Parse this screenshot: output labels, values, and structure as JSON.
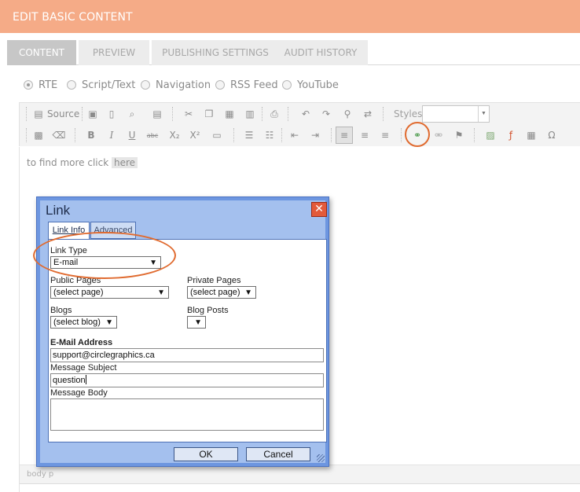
{
  "header": {
    "title": "EDIT BASIC CONTENT"
  },
  "tabs": [
    {
      "label": "CONTENT",
      "active": true
    },
    {
      "label": "PREVIEW",
      "active": false
    },
    {
      "label": "PUBLISHING SETTINGS",
      "active": false
    },
    {
      "label": "AUDIT HISTORY",
      "active": false
    }
  ],
  "content_types": {
    "options": [
      "RTE",
      "Script/Text",
      "Navigation",
      "RSS Feed",
      "YouTube"
    ],
    "selected": "RTE"
  },
  "toolbar": {
    "source_label": "Source",
    "styles_label": "Styles",
    "styles_value": "",
    "row1_icons": [
      "source-icon",
      "save-icon",
      "new-page-icon",
      "preview-icon",
      "templates-icon",
      "cut-icon",
      "copy-icon",
      "paste-icon",
      "paste-text-icon",
      "print-icon",
      "undo-icon",
      "redo-icon",
      "find-icon",
      "replace-icon"
    ],
    "row2_icons": [
      "select-all-icon",
      "remove-format-icon",
      "bold-icon",
      "italic-icon",
      "underline-icon",
      "strike-icon",
      "subscript-icon",
      "superscript-icon",
      "horizontal-rule-icon",
      "numbered-list-icon",
      "bulleted-list-icon",
      "outdent-icon",
      "indent-icon",
      "align-left-icon",
      "align-center-icon",
      "align-right-icon",
      "link-icon",
      "unlink-icon",
      "anchor-icon",
      "image-icon",
      "flash-icon",
      "table-icon",
      "special-char-icon"
    ],
    "glyphs": {
      "bold": "B",
      "italic": "I",
      "underline": "U",
      "strike": "abc",
      "subscript": "X₂",
      "superscript": "X²",
      "special_char": "Ω"
    }
  },
  "editor": {
    "text_before": "to find more click",
    "link_text": "here",
    "status_path": "body   p"
  },
  "dialog": {
    "title": "Link",
    "close_glyph": "✕",
    "tabs": [
      "Link Info",
      "Advanced"
    ],
    "link_type_label": "Link Type",
    "link_type_value": "E-mail",
    "public_pages_label": "Public Pages",
    "public_pages_value": "(select page)",
    "private_pages_label": "Private Pages",
    "private_pages_value": "(select page)",
    "blogs_label": "Blogs",
    "blogs_value": "(select blog)",
    "blog_posts_label": "Blog Posts",
    "blog_posts_value": "",
    "email_label": "E-Mail Address",
    "email_value": "support@circlegraphics.ca",
    "subject_label": "Message Subject",
    "subject_value": "question",
    "body_label": "Message Body",
    "body_value": "",
    "ok_label": "OK",
    "cancel_label": "Cancel",
    "arrow_glyph": "▼"
  },
  "colors": {
    "header_bg": "#f5ab87",
    "annotation": "#e06b30",
    "dialog_frame": "#6d96e0"
  }
}
